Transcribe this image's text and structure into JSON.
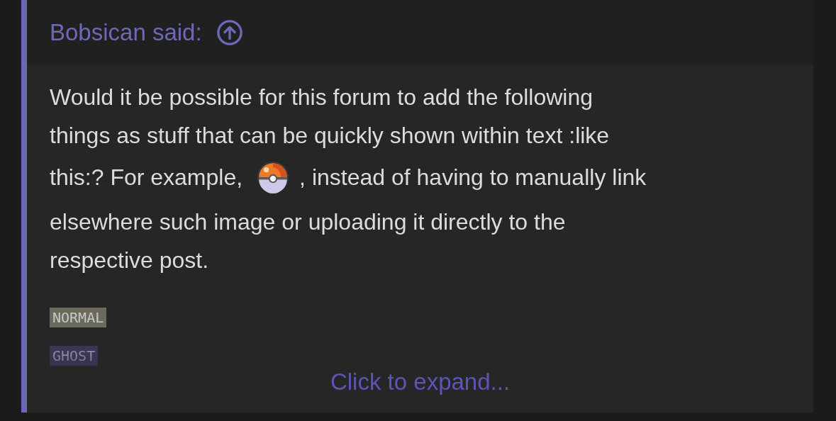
{
  "quote": {
    "author_line": "Bobsican said:",
    "lines": [
      [
        {
          "kind": "text",
          "text": "Would it be possible for this forum to add the following"
        }
      ],
      [
        {
          "kind": "text",
          "text": "things as stuff that can be quickly shown within text :like"
        }
      ],
      [
        {
          "kind": "text",
          "text": "this:? For example,"
        },
        {
          "kind": "emoji"
        },
        {
          "kind": "text",
          "text": ", instead of having to manually link"
        }
      ],
      [
        {
          "kind": "text",
          "text": "elsewhere such image or uploading it directly to the"
        }
      ],
      [
        {
          "kind": "text",
          "text": "respective post."
        }
      ]
    ],
    "badges": [
      {
        "text": "NORMAL",
        "color": "#6b6a5c"
      },
      {
        "text": "GHOST",
        "color": "#3b3654"
      }
    ],
    "expand_link": "Click to expand..."
  }
}
